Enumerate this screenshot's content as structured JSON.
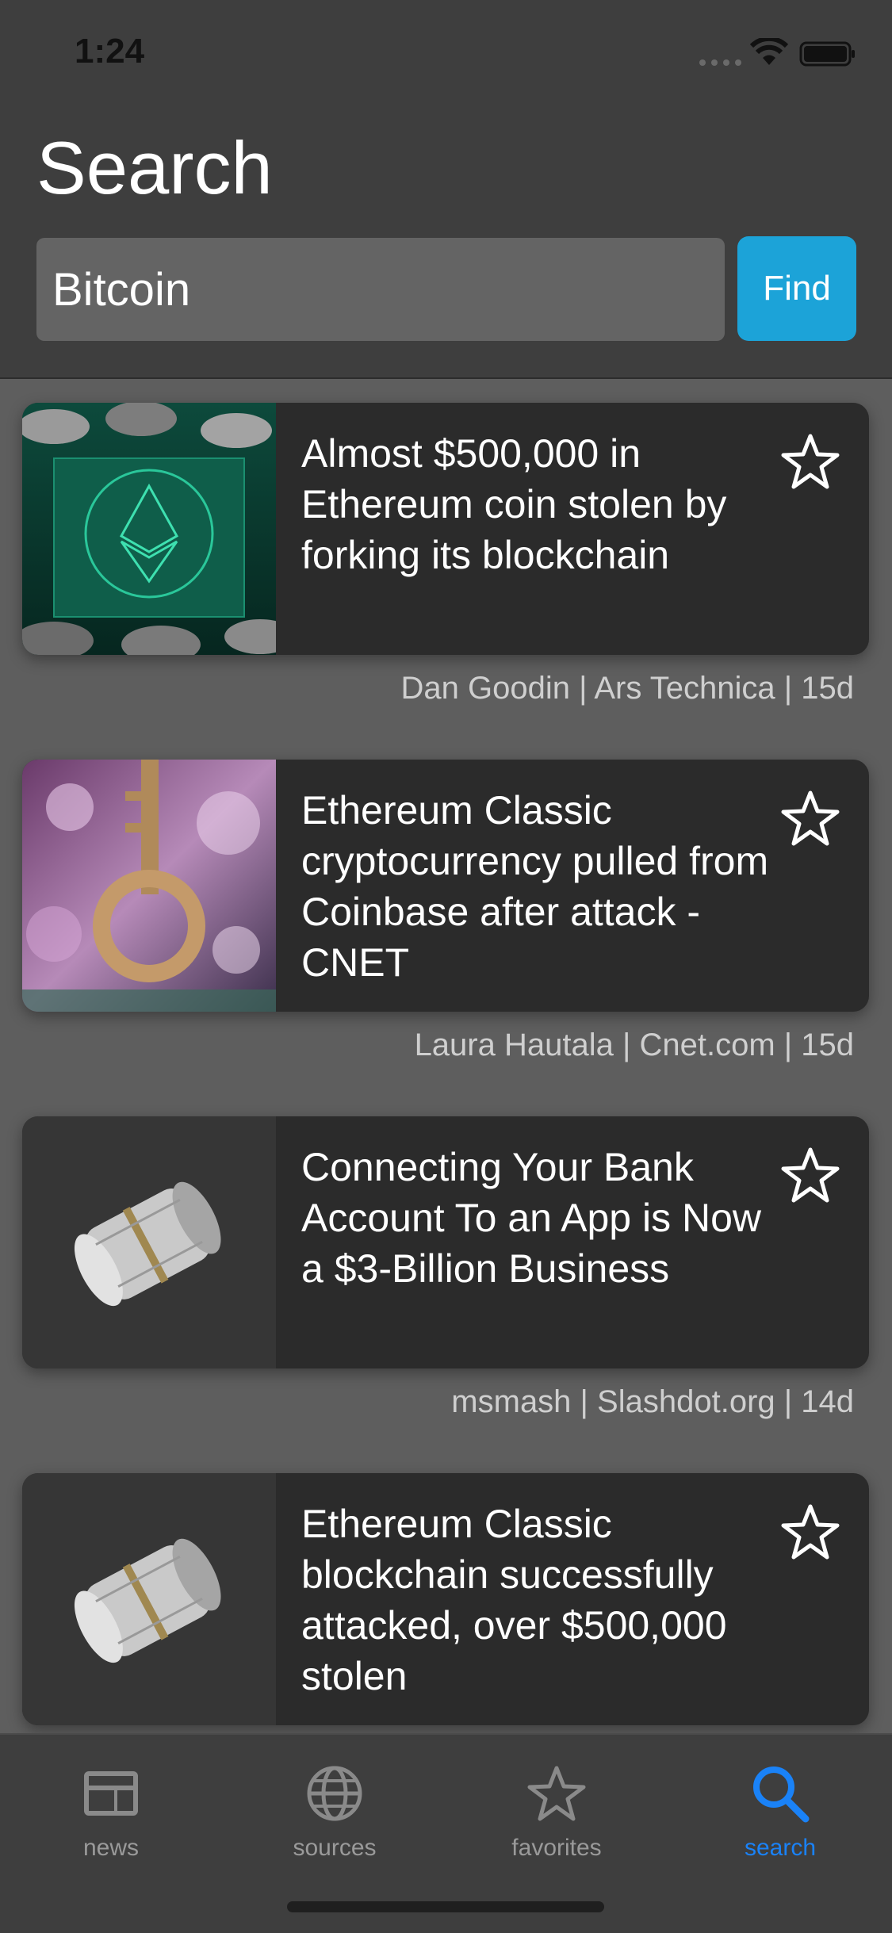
{
  "status_bar": {
    "time": "1:24"
  },
  "header": {
    "title": "Search"
  },
  "search": {
    "value": "Bitcoin",
    "find_label": "Find"
  },
  "articles": [
    {
      "title": "Almost $500,000 in Ethereum coin stolen by forking its blockchain",
      "meta": "Dan Goodin | Ars Technica | 15d",
      "thumbnail": "ethereum-coin-image"
    },
    {
      "title": "Ethereum Classic cryptocurrency pulled from Coinbase after attack - CNET",
      "meta": "Laura Hautala | Cnet.com | 15d",
      "thumbnail": "key-image"
    },
    {
      "title": "Connecting Your Bank Account To an App is Now a $3-Billion Business",
      "meta": "msmash | Slashdot.org | 14d",
      "thumbnail": "newspaper-roll-image"
    },
    {
      "title": "Ethereum Classic blockchain successfully attacked, over $500,000 stolen",
      "meta": "",
      "thumbnail": "newspaper-roll-image"
    }
  ],
  "tabs": [
    {
      "label": "news",
      "icon": "news-icon",
      "active": false
    },
    {
      "label": "sources",
      "icon": "globe-icon",
      "active": false
    },
    {
      "label": "favorites",
      "icon": "star-icon",
      "active": false
    },
    {
      "label": "search",
      "icon": "search-icon",
      "active": true
    }
  ],
  "colors": {
    "accent": "#1ca3d8",
    "active_tab": "#1a82f7",
    "header_bg": "#3e3e3e",
    "card_bg": "#2b2b2b"
  }
}
